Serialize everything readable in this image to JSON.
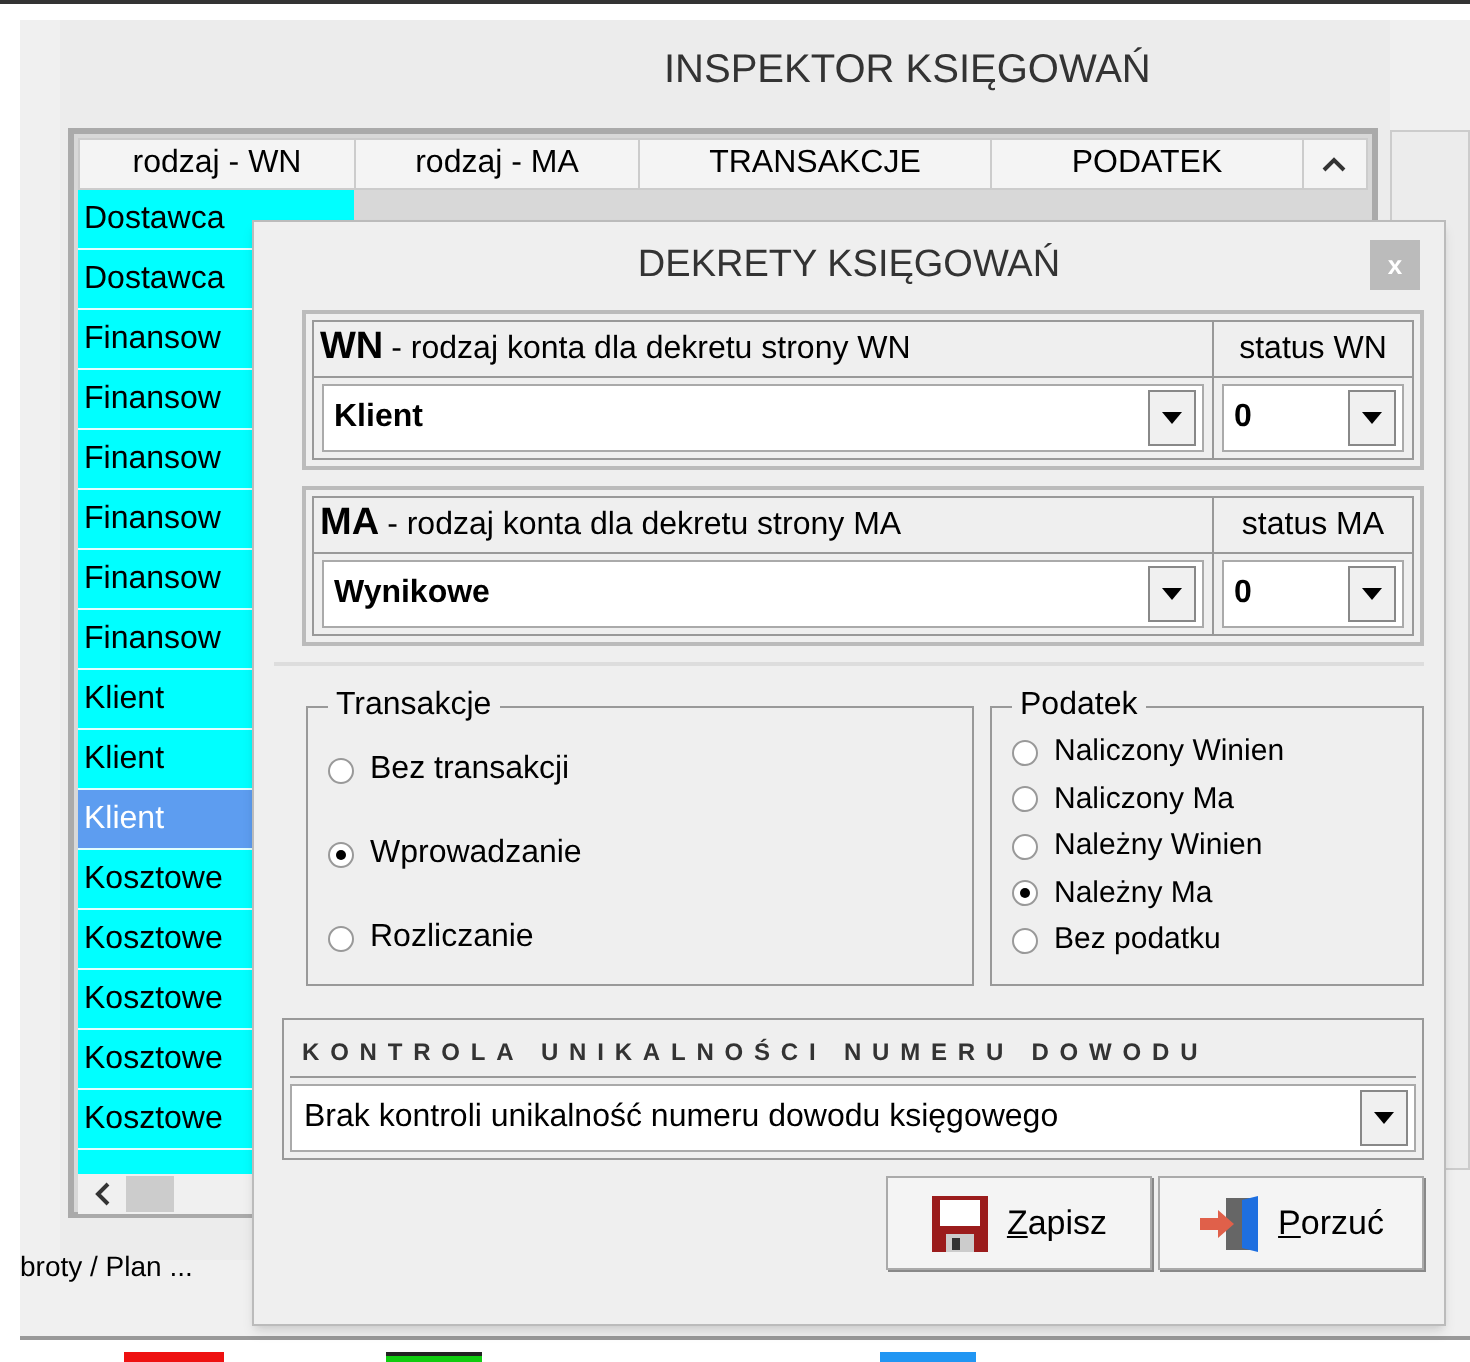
{
  "window": {
    "title": "INSPEKTOR KSIĘGOWAŃ"
  },
  "table": {
    "columns": [
      "rodzaj - WN",
      "rodzaj - MA",
      "TRANSAKCJE",
      "PODATEK"
    ],
    "rows": [
      {
        "wn": "Dostawca",
        "selected": false
      },
      {
        "wn": "Dostawca",
        "selected": false
      },
      {
        "wn": "Finansow",
        "selected": false
      },
      {
        "wn": "Finansow",
        "selected": false
      },
      {
        "wn": "Finansow",
        "selected": false
      },
      {
        "wn": "Finansow",
        "selected": false
      },
      {
        "wn": "Finansow",
        "selected": false
      },
      {
        "wn": "Finansow",
        "selected": false
      },
      {
        "wn": "Klient",
        "selected": false
      },
      {
        "wn": "Klient",
        "selected": false
      },
      {
        "wn": "Klient",
        "selected": true
      },
      {
        "wn": "Kosztowe",
        "selected": false
      },
      {
        "wn": "Kosztowe",
        "selected": false
      },
      {
        "wn": "Kosztowe",
        "selected": false
      },
      {
        "wn": "Kosztowe",
        "selected": false
      },
      {
        "wn": "Kosztowe",
        "selected": false
      }
    ]
  },
  "background_status": "broty / Plan ...",
  "dialog": {
    "title": "DEKRETY KSIĘGOWAŃ",
    "close": "x",
    "sides": [
      {
        "code": "WN",
        "label": "- rodzaj konta dla dekretu strony  WN",
        "status_label": "status WN",
        "value": "Klient",
        "status": "0"
      },
      {
        "code": "MA",
        "label": "- rodzaj konta dla dekretu strony  MA",
        "status_label": "status MA",
        "value": "Wynikowe",
        "status": "0"
      }
    ],
    "transakcje": {
      "title": "Transakcje",
      "options": [
        {
          "label": "Bez transakcji",
          "selected": false
        },
        {
          "label": "Wprowadzanie",
          "selected": true
        },
        {
          "label": "Rozliczanie",
          "selected": false
        }
      ]
    },
    "podatek": {
      "title": "Podatek",
      "options": [
        {
          "label": "Naliczony Winien",
          "selected": false
        },
        {
          "label": "Naliczony Ma",
          "selected": false
        },
        {
          "label": "Należny Winien",
          "selected": false
        },
        {
          "label": "Należny Ma",
          "selected": true
        },
        {
          "label": "Bez podatku",
          "selected": false
        }
      ]
    },
    "kontrola": {
      "title": "KONTROLA UNIKALNOŚCI NUMERU DOWODU",
      "value": "Brak kontroli unikalność numeru dowodu księgowego"
    },
    "buttons": [
      {
        "kind": "save",
        "accel": "Z",
        "rest": "apisz"
      },
      {
        "kind": "cancel",
        "accel": "P",
        "rest": "orzuć"
      }
    ]
  }
}
